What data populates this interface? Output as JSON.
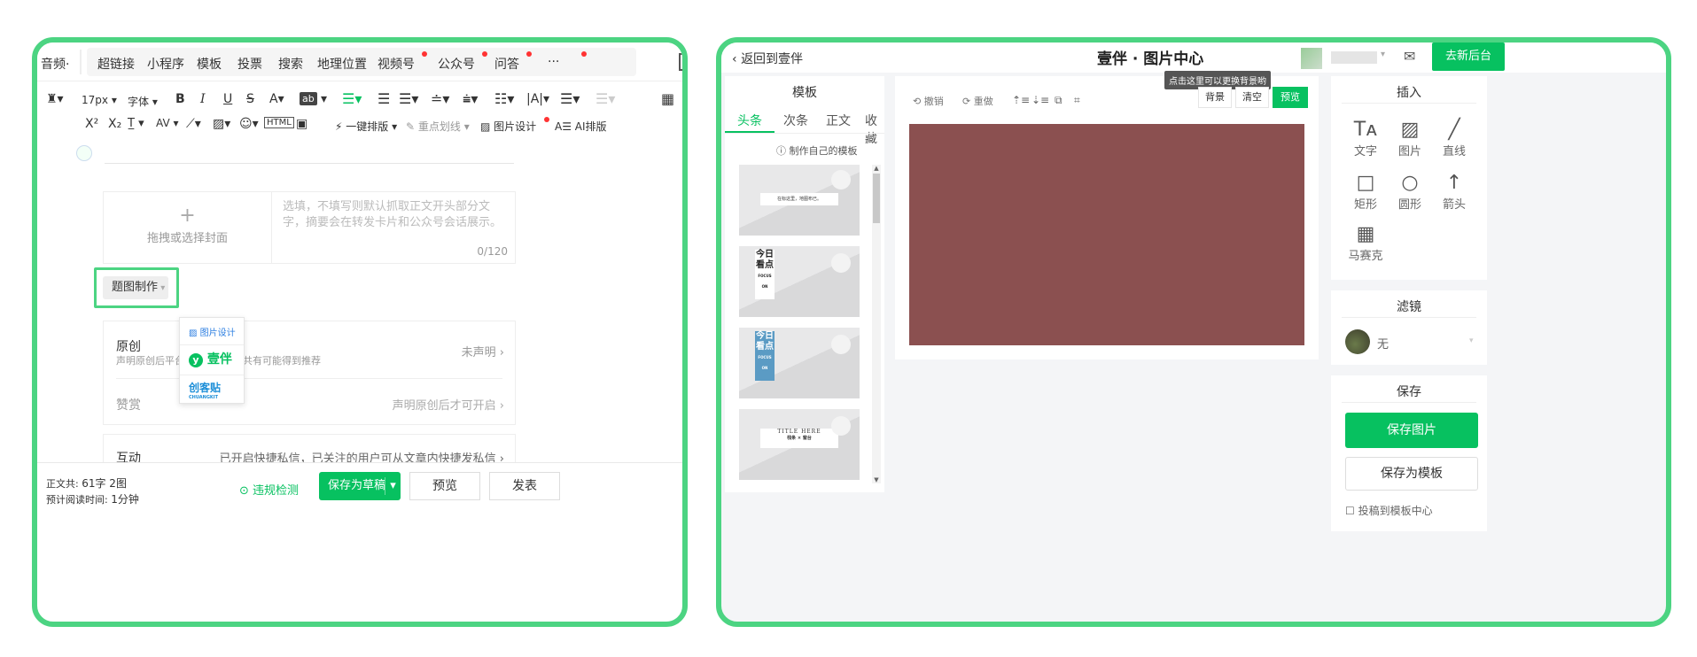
{
  "left": {
    "tabs": [
      {
        "label": "音频·",
        "dot": false
      },
      {
        "label": "超链接",
        "dot": false
      },
      {
        "label": "小程序",
        "dot": false
      },
      {
        "label": "模板",
        "dot": false
      },
      {
        "label": "投票",
        "dot": false
      },
      {
        "label": "搜索",
        "dot": false
      },
      {
        "label": "地理位置",
        "dot": false
      },
      {
        "label": "视频号",
        "dot": true
      },
      {
        "label": "公众号",
        "dot": true
      },
      {
        "label": "问答",
        "dot": true
      },
      {
        "label": "···",
        "dot": true
      }
    ],
    "toolbar": {
      "font_size": "17px",
      "font_family": "字体",
      "bold": "B",
      "italic": "I",
      "underline": "U",
      "strike": "S",
      "font_color": "A",
      "bg_color": "ab",
      "superscript": "X²",
      "subscript": "X₂",
      "one_click_layout": "一键排版",
      "highlight_line": "重点划线",
      "image_design": "图片设计",
      "ai_layout": "AI排版"
    },
    "cover": {
      "plus": "+",
      "placeholder": "拖拽或选择封面"
    },
    "summary": {
      "placeholder": "选填，不填写则默认抓取正文开头部分文字，摘要会在转发卡片和公众号会话展示。",
      "counter": "0/120"
    },
    "title_image_button": "题图制作",
    "dropdown": {
      "item1": "图片设计",
      "item2": "壹伴",
      "item3": "创客贴",
      "item3_sub": "CHUANGKIT"
    },
    "original": {
      "title": "原创",
      "desc": "声明原创后平台著作权保护，共有可能得到推荐",
      "status": "未声明 ›"
    },
    "reward": {
      "title": "赞赏",
      "status": "声明原创后才可开启 ›"
    },
    "interact": {
      "title": "互动",
      "desc": "已开启快捷私信，已关注的用户可从文章内快捷发私信 ›"
    },
    "footer": {
      "count_label": "正文共:",
      "count_value": "61字 2图",
      "read_label": "预计阅读时间:",
      "read_value": "1分钟",
      "check": "违规检测",
      "save_draft": "保存为草稿",
      "preview": "预览",
      "publish": "发表"
    }
  },
  "right": {
    "back": "返回到壹伴",
    "title": "壹伴 · 图片中心",
    "to_new": "去新后台",
    "templates": {
      "header": "模板",
      "tabs": [
        "头条",
        "次条",
        "正文",
        "收藏"
      ],
      "make_own": "制作自己的模板",
      "thumb1_text": "在标这里，地图布已。",
      "thumb2_text": "今日看点",
      "thumb2_sub": "FOCUS ON",
      "thumb3_text": "今日看点",
      "thumb3_sub": "FOCUS ON",
      "thumb4_title": "TITLE HERE",
      "thumb4_sub": "栈条 × 窗台"
    },
    "canvas": {
      "undo": "撤销",
      "redo": "重做",
      "tooltip": "点击这里可以更换背景哟",
      "bg_btn": "背景",
      "clear_btn": "清空",
      "preview_btn": "预览",
      "bg_color": "#8b5050"
    },
    "insert": {
      "header": "插入",
      "items": [
        {
          "icon": "Tᴀ",
          "label": "文字"
        },
        {
          "icon": "▨",
          "label": "图片"
        },
        {
          "icon": "╱",
          "label": "直线"
        },
        {
          "icon": "□",
          "label": "矩形"
        },
        {
          "icon": "○",
          "label": "圆形"
        },
        {
          "icon": "↑",
          "label": "箭头"
        },
        {
          "icon": "▦",
          "label": "马赛克"
        }
      ]
    },
    "filter": {
      "header": "滤镜",
      "value": "无"
    },
    "save": {
      "header": "保存",
      "save_image": "保存图片",
      "save_template": "保存为模板",
      "submit": "投稿到模板中心"
    }
  }
}
